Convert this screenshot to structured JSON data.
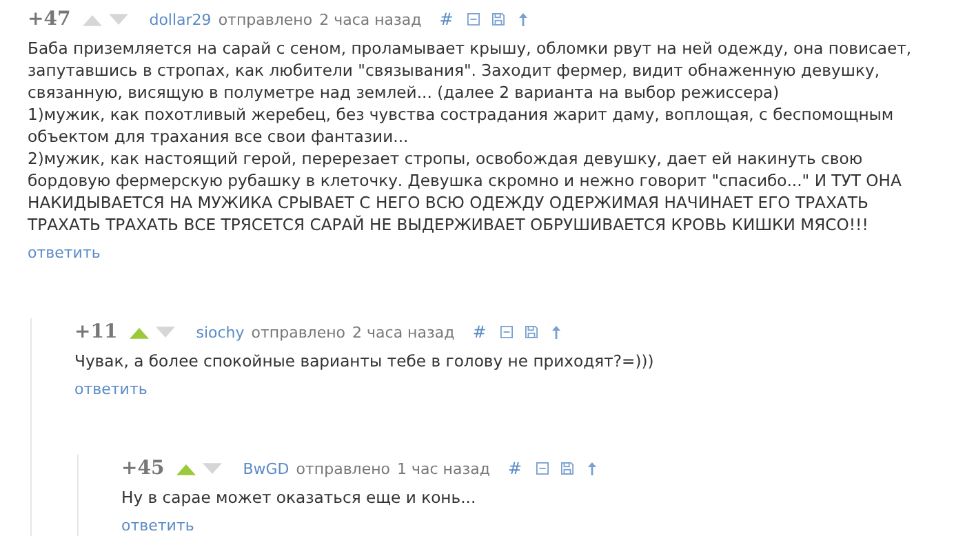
{
  "comments": [
    {
      "score": "+47",
      "upvoted": false,
      "author": "dollar29",
      "posted": "отправлено",
      "time": "2 часа назад",
      "link_symbol": "#",
      "body": [
        "Баба приземляется на сарай с сеном, проламывает крышу, обломки рвут на ней одежду, она повисает, запутавшись в стропах, как любители \"связывания\". Заходит фермер, видит обнаженную девушку, связанную, висящую в полуметре над землей... (далее 2 варианта на выбор режиссера)",
        "1)мужик, как похотливый жеребец, без чувства сострадания жарит даму, воплощая, с беспомощным объектом для трахания все свои фантазии...",
        "2)мужик, как настоящий герой, перерезает стропы, освобождая девушку, дает ей накинуть свою бордовую фермерскую рубашку в клеточку. Девушка скромно и нежно говорит \"спасибо...\" И ТУТ ОНА НАКИДЫВАЕТСЯ НА МУЖИКА СРЫВАЕТ С НЕГО ВСЮ ОДЕЖДУ ОДЕРЖИМАЯ НАЧИНАЕТ ЕГО ТРАХАТЬ ТРАХАТЬ ТРАХАТЬ ВСЕ ТРЯСЕТСЯ САРАЙ НЕ ВЫДЕРЖИВАЕТ ОБРУШИВАЕТСЯ КРОВЬ КИШКИ МЯСО!!!"
      ],
      "reply": "ответить",
      "children": [
        {
          "score": "+11",
          "upvoted": true,
          "author": "siochy",
          "posted": "отправлено",
          "time": "2 часа назад",
          "link_symbol": "#",
          "body": [
            "Чувак, а более спокойные варианты тебе в голову не приходят?=)))"
          ],
          "reply": "ответить",
          "children": [
            {
              "score": "+45",
              "upvoted": true,
              "author": "BwGD",
              "posted": "отправлено",
              "time": "1 час назад",
              "link_symbol": "#",
              "body": [
                "Ну в сарае может оказаться еще и конь..."
              ],
              "reply": "ответить"
            }
          ]
        }
      ]
    }
  ]
}
